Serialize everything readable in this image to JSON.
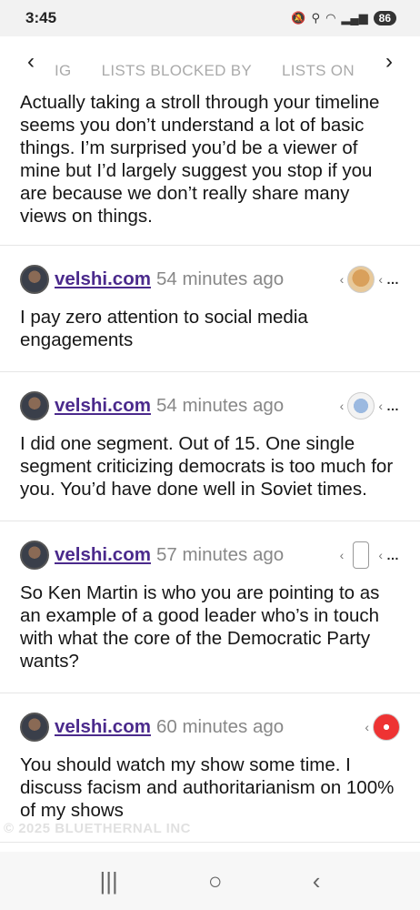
{
  "status_bar": {
    "time": "3:45",
    "icons": [
      "mute-icon",
      "location-icon",
      "wifi-icon",
      "signal-icon"
    ],
    "battery": "86"
  },
  "tabs": {
    "items": [
      "IG",
      "LISTS BLOCKED BY",
      "LISTS ON"
    ],
    "prev_label": "‹",
    "next_label": "›"
  },
  "feed": {
    "first_post_text": "Actually taking a stroll through your timeline seems you don’t understand a lot of basic things. I’m surprised you’d be a viewer of mine but I’d largely suggest you stop if you are because we don’t really share many views on things.",
    "posts": [
      {
        "handle": "velshi.com",
        "time": "54 minutes ago",
        "text": "I pay zero attention to social media engagements",
        "reply_avatar": "dog"
      },
      {
        "handle": "velshi.com",
        "time": "54 minutes ago",
        "text": "I did one segment. Out of 15. One single segment criticizing democrats is too much for you. You’d have done well in Soviet times.",
        "reply_avatar": "sticker"
      },
      {
        "handle": "velshi.com",
        "time": "57 minutes ago",
        "text": "So Ken Martin is who you are pointing to as an example of a good leader who’s in touch with what the core of the Democratic Party wants?",
        "reply_avatar": "phone"
      },
      {
        "handle": "velshi.com",
        "time": "60 minutes ago",
        "text": "You should watch my show some time. I discuss facism and authoritarianism on 100% of my shows",
        "reply_avatar": "red"
      }
    ],
    "reply_chevron": "‹",
    "more": "…"
  },
  "watermark": "© 2025 BLUETHERNAL INC",
  "nav_bar": {
    "recent": "|||",
    "home": "○",
    "back": "‹"
  }
}
